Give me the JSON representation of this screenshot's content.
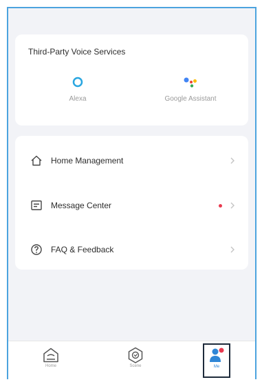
{
  "voice_services": {
    "title": "Third-Party Voice Services",
    "items": [
      {
        "label": "Alexa"
      },
      {
        "label": "Google Assistant"
      }
    ]
  },
  "menu": {
    "items": [
      {
        "label": "Home Management"
      },
      {
        "label": "Message Center",
        "has_notification": true
      },
      {
        "label": "FAQ & Feedback"
      }
    ]
  },
  "tabbar": {
    "items": [
      {
        "label": "Home"
      },
      {
        "label": "Scene"
      },
      {
        "label": "Me",
        "selected": true
      }
    ]
  },
  "colors": {
    "background": "#f2f3f7",
    "frame_border": "#4ba3de",
    "alexa": "#2aa6e0",
    "notification_dot": "#e93a4f",
    "active_tab": "#2f86d6"
  }
}
